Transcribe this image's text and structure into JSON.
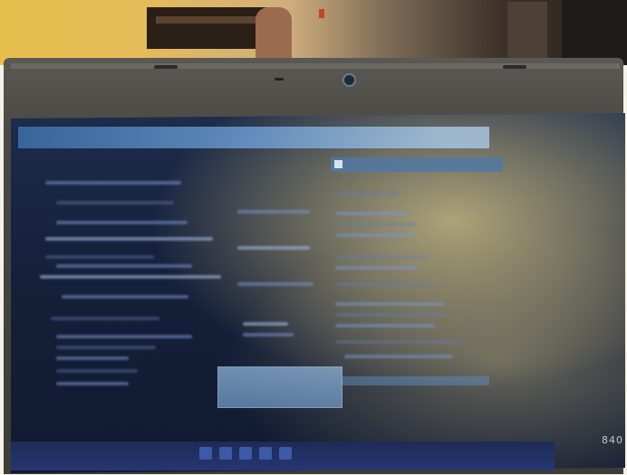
{
  "scene": {
    "subject": "laptop-screen-photo",
    "brand_mark": "840"
  },
  "colors": {
    "wall": "#e5bc58",
    "bezel": "#4a4944",
    "screen": "#15203a",
    "title_bar": "#4f78a8",
    "button": "#8fb4d9"
  },
  "icons": {
    "camera": "webcam-icon",
    "dialog": "window-icon"
  }
}
